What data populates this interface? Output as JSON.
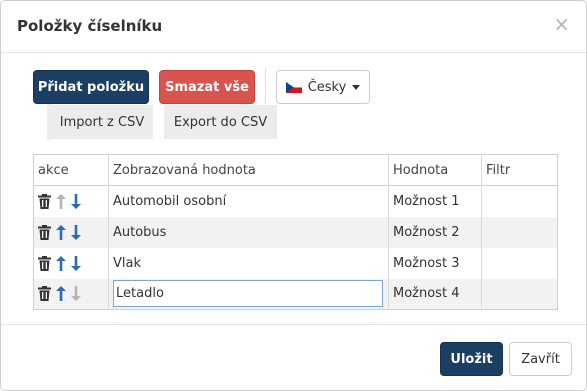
{
  "dialog": {
    "title": "Položky číselníku",
    "close_glyph": "×"
  },
  "toolbar": {
    "add_label": "Přidat položku",
    "delete_all_label": "Smazat vše",
    "language_label": "Česky",
    "import_label": "Import z CSV",
    "export_label": "Export do CSV"
  },
  "table": {
    "headers": [
      "akce",
      "Zobrazovaná hodnota",
      "Hodnota",
      "Filtr"
    ],
    "rows": [
      {
        "display": "Automobil osobní",
        "value": "Možnost 1",
        "filter": "",
        "up_enabled": false,
        "down_enabled": true
      },
      {
        "display": "Autobus",
        "value": "Možnost 2",
        "filter": "",
        "up_enabled": true,
        "down_enabled": true
      },
      {
        "display": "Vlak",
        "value": "Možnost 3",
        "filter": "",
        "up_enabled": true,
        "down_enabled": true
      },
      {
        "display": "Letadlo",
        "value": "Možnost 4",
        "filter": "",
        "up_enabled": true,
        "down_enabled": false,
        "editing": true
      }
    ]
  },
  "footer": {
    "save_label": "Uložit",
    "close_label": "Zavřít"
  },
  "colors": {
    "primary": "#1b3f63",
    "danger": "#d9534f",
    "arrow_active": "#2a6db3",
    "arrow_disabled": "#b5b5b5"
  },
  "icons": {
    "trash": "trash-icon",
    "up": "arrow-up-icon",
    "down": "arrow-down-icon",
    "flag": "czech-flag-icon",
    "caret": "caret-down-icon"
  }
}
